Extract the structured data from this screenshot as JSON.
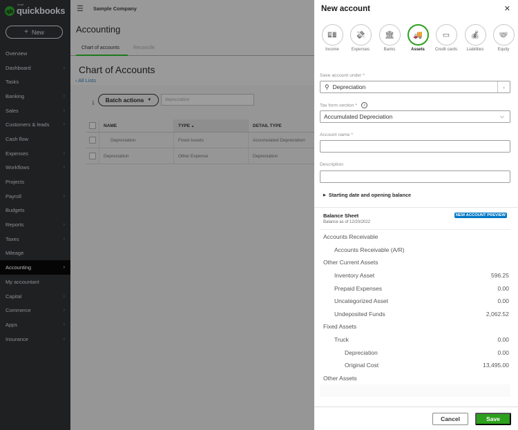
{
  "sidebar": {
    "logo_small": "intuit",
    "logo_text": "quickbooks",
    "new_label": "New",
    "items": [
      {
        "label": "Overview",
        "has_chevron": false
      },
      {
        "label": "Dashboard",
        "has_chevron": true
      },
      {
        "label": "Tasks",
        "has_chevron": false
      },
      {
        "label": "Banking",
        "has_chevron": true
      },
      {
        "label": "Sales",
        "has_chevron": true
      },
      {
        "label": "Customers & leads",
        "has_chevron": true
      },
      {
        "label": "Cash flow",
        "has_chevron": false
      },
      {
        "label": "Expenses",
        "has_chevron": true
      },
      {
        "label": "Workflows",
        "has_chevron": true
      },
      {
        "label": "Projects",
        "has_chevron": false
      },
      {
        "label": "Payroll",
        "has_chevron": true
      },
      {
        "label": "Budgets",
        "has_chevron": false
      },
      {
        "label": "Reports",
        "has_chevron": true
      },
      {
        "label": "Taxes",
        "has_chevron": true
      },
      {
        "label": "Mileage",
        "has_chevron": false
      },
      {
        "label": "Accounting",
        "has_chevron": true,
        "active": true
      },
      {
        "label": "My accountant",
        "has_chevron": false
      },
      {
        "label": "Capital",
        "has_chevron": true
      },
      {
        "label": "Commerce",
        "has_chevron": true
      },
      {
        "label": "Apps",
        "has_chevron": true
      },
      {
        "label": "Insurance",
        "has_chevron": true
      }
    ]
  },
  "main": {
    "company": "Sample Company",
    "page_title": "Accounting",
    "tabs": [
      {
        "label": "Chart of accounts",
        "active": true
      },
      {
        "label": "Reconcile",
        "active": false
      }
    ],
    "section_title": "Chart of Accounts",
    "back_link": "All Lists",
    "batch_actions": "Batch actions",
    "search_value": "depreciation",
    "table": {
      "headers": [
        "NAME",
        "TYPE",
        "DETAIL TYPE"
      ],
      "sort_indicator": "▲",
      "rows": [
        {
          "name": "Depreciation",
          "type": "Fixed Assets",
          "detail": "Accumulated Depreciation",
          "subaccount": true
        },
        {
          "name": "Depreciation",
          "type": "Other Expense",
          "detail": "Depreciation",
          "subaccount": false
        }
      ]
    }
  },
  "drawer": {
    "title": "New account",
    "account_types": [
      {
        "label": "Income",
        "icon": "income-icon",
        "glyph": "💵",
        "selected": false
      },
      {
        "label": "Expenses",
        "icon": "expenses-icon",
        "glyph": "💸",
        "selected": false
      },
      {
        "label": "Banks",
        "icon": "bank-icon",
        "glyph": "🏛",
        "selected": false
      },
      {
        "label": "Assets",
        "icon": "truck-icon",
        "glyph": "🚚",
        "selected": true
      },
      {
        "label": "Credit cards",
        "icon": "credit-card-icon",
        "glyph": "▭",
        "selected": false
      },
      {
        "label": "Liabilities",
        "icon": "liabilities-icon",
        "glyph": "💰",
        "selected": false
      },
      {
        "label": "Equity",
        "icon": "equity-icon",
        "glyph": "🤝",
        "selected": false
      }
    ],
    "save_under_label": "Save account under *",
    "save_under_value": "Depreciation",
    "tax_form_label": "Tax form section *",
    "tax_form_value": "Accumulated Depreciation",
    "account_name_label": "Account name *",
    "account_name_value": "",
    "description_label": "Description",
    "description_value": "",
    "expander_label": "Starting date and opening balance",
    "balance_sheet": {
      "title": "Balance Sheet",
      "subtitle": "Balance as of 12/20/2022",
      "badge": "NEW ACCOUNT PREVIEW",
      "rows": [
        {
          "label": "Accounts Receivable",
          "level": 0,
          "amount": ""
        },
        {
          "label": "Accounts Receivable (A/R)",
          "level": 1,
          "amount": ""
        },
        {
          "label": "Other Current Assets",
          "level": 0,
          "amount": ""
        },
        {
          "label": "Inventory Asset",
          "level": 1,
          "amount": "596.25"
        },
        {
          "label": "Prepaid Expenses",
          "level": 1,
          "amount": "0.00"
        },
        {
          "label": "Uncategorized Asset",
          "level": 1,
          "amount": "0.00"
        },
        {
          "label": "Undeposited Funds",
          "level": 1,
          "amount": "2,062.52"
        },
        {
          "label": "Fixed Assets",
          "level": 0,
          "amount": ""
        },
        {
          "label": "Truck",
          "level": 1,
          "amount": "0.00"
        },
        {
          "label": "Depreciation",
          "level": 2,
          "amount": "0.00"
        },
        {
          "label": "Original Cost",
          "level": 2,
          "amount": "13,495.00"
        },
        {
          "label": "Other Assets",
          "level": 0,
          "amount": ""
        }
      ]
    },
    "cancel_label": "Cancel",
    "save_label": "Save"
  },
  "colors": {
    "brand_green": "#2ca01c",
    "badge_blue": "#0077c5",
    "sidebar_bg": "#1f2022"
  }
}
